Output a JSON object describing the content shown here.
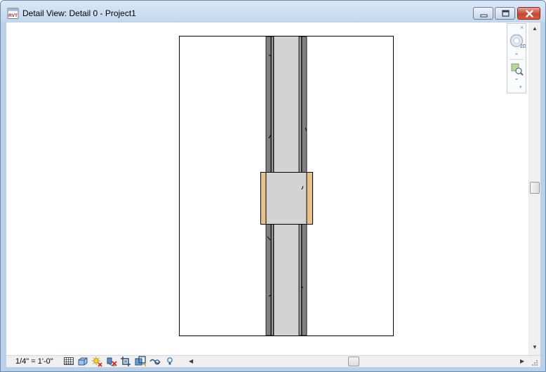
{
  "window": {
    "title": "Detail View: Detail 0 - Project1",
    "app_icon": "revit-rvt-icon",
    "app_icon_text": "RVT",
    "controls": [
      "minimize-icon",
      "maximize-icon",
      "close-icon"
    ]
  },
  "view_nav": {
    "close_glyph": "×",
    "wheel_badge": "2D",
    "icons": [
      "navigation-wheel-icon",
      "zoom-region-icon"
    ]
  },
  "status_bar": {
    "scale": "1/4\" = 1'-0\"",
    "tools": [
      "detail-level-icon",
      "visual-style-icon",
      "sun-path-icon",
      "shadows-off-icon",
      "crop-view-icon",
      "show-crop-region-icon",
      "temporary-hide-isolate-icon",
      "reveal-hidden-elements-icon"
    ]
  },
  "colors": {
    "wall_core": "#d3d3d3",
    "wall_layer": "#808080",
    "insert": "#e8c48a",
    "title_bar": "#c3d7ee",
    "close_button": "#c6472f"
  }
}
